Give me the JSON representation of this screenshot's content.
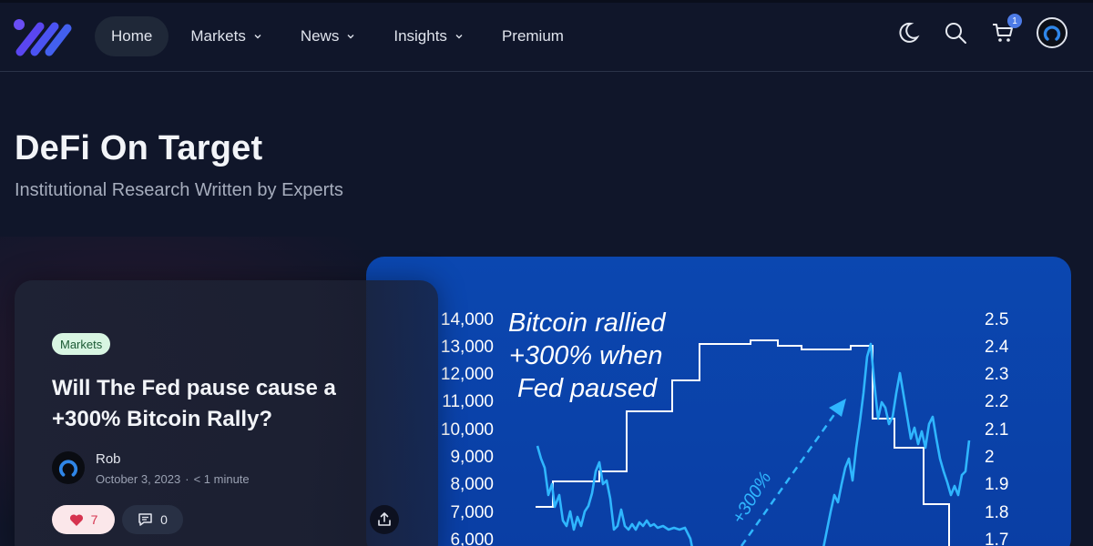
{
  "nav": {
    "items": [
      {
        "label": "Home",
        "active": true,
        "dropdown": false
      },
      {
        "label": "Markets",
        "active": false,
        "dropdown": true
      },
      {
        "label": "News",
        "active": false,
        "dropdown": true
      },
      {
        "label": "Insights",
        "active": false,
        "dropdown": true
      },
      {
        "label": "Premium",
        "active": false,
        "dropdown": false
      }
    ],
    "icons": [
      "moon-icon",
      "search-icon",
      "cart-icon",
      "avatar"
    ],
    "cart_count": "1"
  },
  "site": {
    "title": "DeFi On Target",
    "subtitle": "Institutional Research Written by Experts"
  },
  "post": {
    "tag": "Markets",
    "title": "Will The Fed pause cause a +300% Bitcoin Rally?",
    "author": "Rob",
    "date": "October 3, 2023",
    "separator": "·",
    "read_time": "< 1 minute",
    "likes": "7",
    "comments": "0"
  },
  "hero_chart": {
    "annotation_lines": [
      "Bitcoin rallied",
      "+300% when",
      "Fed paused"
    ],
    "arrow_label": "+300%",
    "left_ticks": [
      "14,000",
      "13,000",
      "12,000",
      "11,000",
      "10,000",
      "9,000",
      "8,000",
      "7,000",
      "6,000"
    ],
    "right_ticks": [
      "2.5",
      "2.4",
      "2.3",
      "2.2",
      "2.1",
      "2",
      "1.9",
      "1.8",
      "1.7"
    ]
  },
  "colors": {
    "background": "#10162a",
    "accent": "#4d7be6",
    "chart_bg": "#0b47b0",
    "chart_line": "#2fb6ff"
  }
}
